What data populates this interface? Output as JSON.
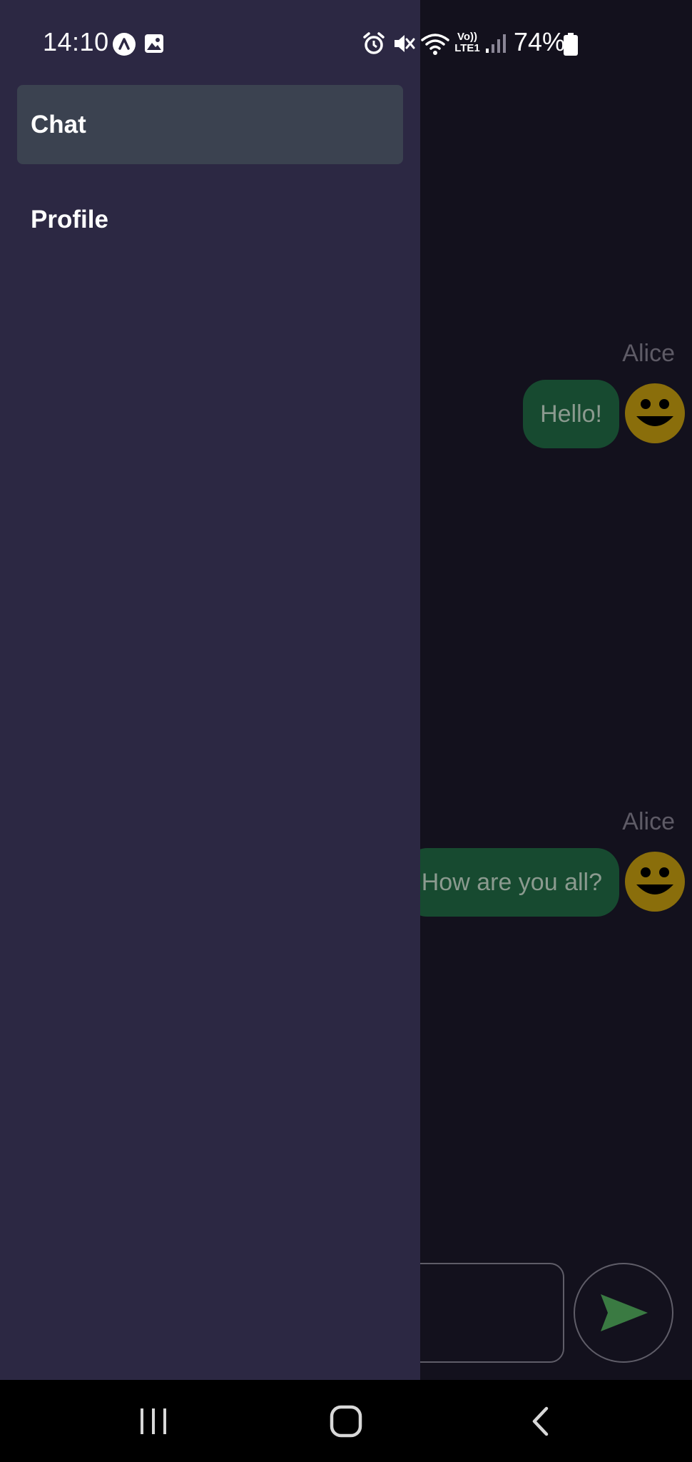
{
  "status_bar": {
    "time": "14:10",
    "battery": "74%",
    "network_top": "Vo))",
    "network_bottom": "LTE1",
    "icons": [
      "app-a-icon",
      "gallery-icon",
      "alarm-icon",
      "mute-icon",
      "wifi-icon",
      "signal-icon",
      "battery-icon"
    ]
  },
  "drawer": {
    "items": [
      {
        "label": "Chat",
        "active": true
      },
      {
        "label": "Profile",
        "active": false
      }
    ]
  },
  "chat": {
    "messages": [
      {
        "sender": "Alice",
        "text": "Hello!"
      },
      {
        "sender": "Alice",
        "text": "How are you all?"
      }
    ],
    "input_value": "",
    "send_icon": "send-icon"
  },
  "nav_bar": {
    "buttons": [
      "recents-icon",
      "home-icon",
      "back-icon"
    ]
  },
  "colors": {
    "drawer_bg": "#2c2843",
    "drawer_active_bg": "#3b4250",
    "chat_bg": "#13111d",
    "bubble_bg": "#174a30",
    "avatar_face": "#8a6e0b",
    "send_arrow": "#3a7a42"
  }
}
